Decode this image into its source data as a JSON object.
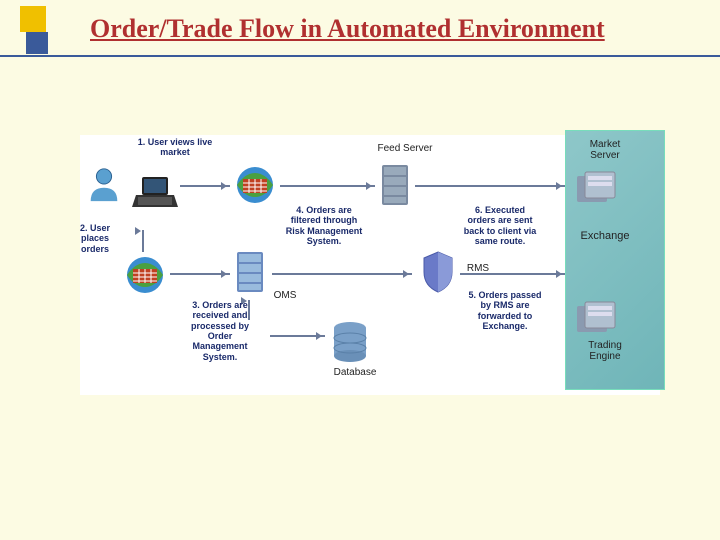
{
  "title": "Order/Trade Flow in Automated Environment",
  "steps": {
    "s1": "1. User views live market",
    "s2": "2. User places orders",
    "s3": "3. Orders are received and processed by Order Management System.",
    "s4": "4. Orders are filtered through Risk Management System.",
    "s5": "5. Orders passed by RMS are forwarded to Exchange.",
    "s6": "6. Executed orders are sent back to client via same route."
  },
  "components": {
    "feedServer": "Feed Server",
    "marketServer": "Market Server",
    "exchange": "Exchange",
    "tradingEngine": "Trading Engine",
    "oms": "OMS",
    "rms": "RMS",
    "database": "Database"
  }
}
